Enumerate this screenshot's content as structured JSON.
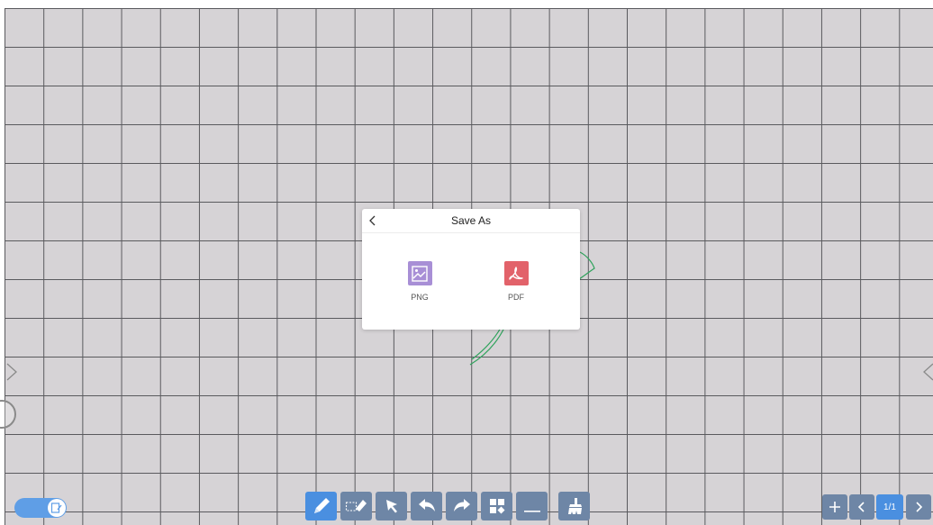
{
  "dialog": {
    "title": "Save As",
    "options": [
      {
        "label": "PNG",
        "icon": "image-icon",
        "color": "#a88fd6"
      },
      {
        "label": "PDF",
        "icon": "pdf-icon",
        "color": "#e2626a"
      }
    ]
  },
  "toolbar": {
    "tools": [
      {
        "name": "pen-tool",
        "icon": "pen-icon",
        "active": true
      },
      {
        "name": "eraser-tool",
        "icon": "eraser-icon"
      },
      {
        "name": "select-tool",
        "icon": "cursor-arrow-icon"
      },
      {
        "name": "undo",
        "icon": "undo-icon"
      },
      {
        "name": "redo",
        "icon": "redo-icon"
      },
      {
        "name": "more-tools",
        "icon": "grid-shapes-icon"
      },
      {
        "name": "collapse",
        "icon": "minus-icon"
      },
      {
        "name": "clear-board",
        "icon": "broom-icon"
      }
    ]
  },
  "pager": {
    "page_indicator": "1/1"
  },
  "colors": {
    "canvas": "#d6d3d6",
    "grid_line": "#5a5a5e",
    "accent": "#4a8fe0",
    "tool_button": "#6e86a6",
    "stroke": "#2fa35c"
  }
}
